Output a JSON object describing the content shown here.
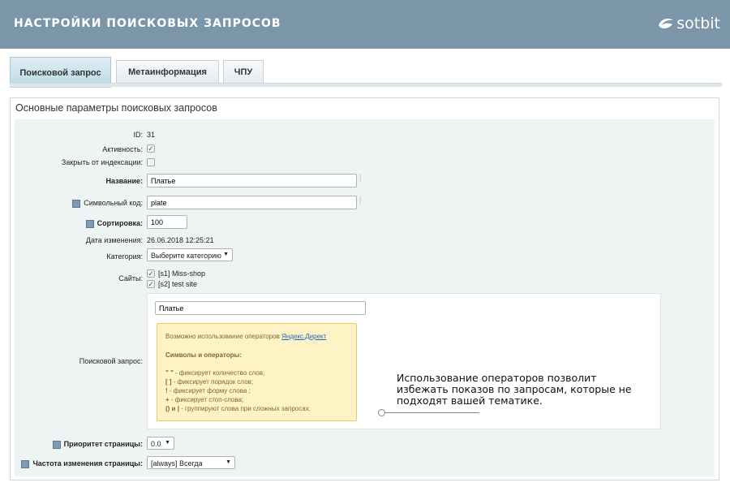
{
  "header": {
    "title": "НАСТРОЙКИ ПОИСКОВЫХ ЗАПРОСОВ",
    "logo_text": "sotbit"
  },
  "tabs": [
    {
      "label": "Поисковой запрос"
    },
    {
      "label": "Метаинформация"
    },
    {
      "label": "ЧПУ"
    }
  ],
  "panel": {
    "title": "Основные параметры поисковых запросов"
  },
  "form": {
    "id": {
      "label": "ID:",
      "value": "31"
    },
    "active": {
      "label": "Активность:",
      "checked": true
    },
    "noindex": {
      "label": "Закрыть от индексации:",
      "checked": false
    },
    "name": {
      "label": "Название:",
      "value": "Платье"
    },
    "code": {
      "label": "Символьный код:",
      "value": "plate"
    },
    "sort": {
      "label": "Сортировка:",
      "value": "100"
    },
    "date": {
      "label": "Дата изменения:",
      "value": "26.06.2018 12:25:21"
    },
    "category": {
      "label": "Категория:",
      "value": "Выберите категорию"
    },
    "sites": {
      "label": "Сайты:",
      "items": [
        "[s1] Miss-shop",
        "[s2] test site"
      ]
    },
    "query": {
      "label": "Поисковой запрос:",
      "value": "Платье"
    },
    "priority": {
      "label": "Приоритет страницы:",
      "value": "0.0"
    },
    "frequency": {
      "label": "Частота изменения страницы:",
      "value": "[always] Всегда"
    }
  },
  "hint": {
    "intro": "Возможно использование операторов ",
    "link": "Яндекс.Директ",
    "heading": "Символы и операторы:",
    "lines": [
      {
        "op": "\" \"",
        "text": " - фиксирует количество слов;"
      },
      {
        "op": "[ ]",
        "text": " - фиксирует порядок слов;"
      },
      {
        "op": "!",
        "text": " - фиксирует форму слова ;"
      },
      {
        "op": "+",
        "text": " - фиксирует стоп-слова;"
      },
      {
        "op": "() и |",
        "text": " - группируют слова при сложных запросах."
      }
    ]
  },
  "callout": {
    "text": "Использование операторов позволит избежать показов по запросам, которые не подходят вашей тематике."
  }
}
